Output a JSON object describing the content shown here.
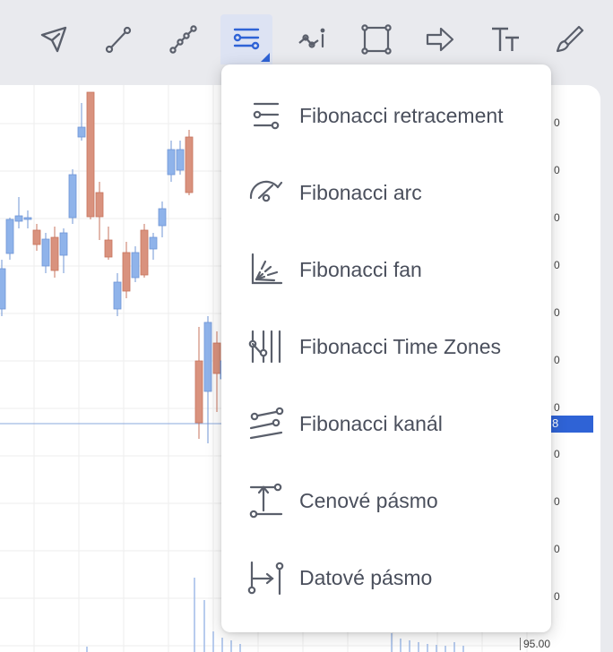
{
  "toolbar": {
    "tools": [
      {
        "icon": "cursor-arrow-icon",
        "active": false
      },
      {
        "icon": "trend-line-icon",
        "active": false
      },
      {
        "icon": "multi-point-line-icon",
        "active": false
      },
      {
        "icon": "fibonacci-tools-icon",
        "active": true
      },
      {
        "icon": "projection-info-icon",
        "active": false
      },
      {
        "icon": "rectangle-icon",
        "active": false
      },
      {
        "icon": "arrow-icon",
        "active": false
      },
      {
        "icon": "text-icon",
        "active": false
      },
      {
        "icon": "brush-icon",
        "active": false
      }
    ],
    "accent_color": "#2f63d6"
  },
  "menu": {
    "items": [
      {
        "label": "Fibonacci retracement",
        "icon": "fibonacci-retracement-icon"
      },
      {
        "label": "Fibonacci arc",
        "icon": "fibonacci-arc-icon"
      },
      {
        "label": "Fibonacci fan",
        "icon": "fibonacci-fan-icon"
      },
      {
        "label": "Fibonacci Time Zones",
        "icon": "fibonacci-time-zones-icon"
      },
      {
        "label": "Fibonacci kanál",
        "icon": "fibonacci-channel-icon"
      },
      {
        "label": "Cenové pásmo",
        "icon": "price-range-icon"
      },
      {
        "label": "Datové pásmo",
        "icon": "date-range-icon"
      }
    ]
  },
  "chart": {
    "axis_tick_suffix": "0",
    "current_price_tag": "8",
    "bottom_axis_value": "95.00",
    "up_color": "#8fb3ea",
    "down_color": "#d9927e"
  }
}
